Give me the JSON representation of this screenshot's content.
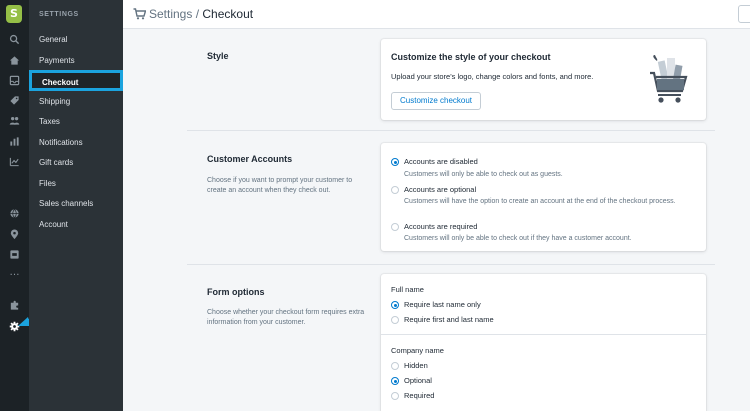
{
  "nav": {
    "heading": "SETTINGS",
    "items": [
      {
        "label": "General"
      },
      {
        "label": "Payments"
      },
      {
        "label": "Checkout"
      },
      {
        "label": "Shipping"
      },
      {
        "label": "Taxes"
      },
      {
        "label": "Notifications"
      },
      {
        "label": "Gift cards"
      },
      {
        "label": "Files"
      },
      {
        "label": "Sales channels"
      },
      {
        "label": "Account"
      }
    ],
    "active": "Checkout",
    "accent_color": "#1ba3de"
  },
  "topbar": {
    "breadcrumb_parent": "Settings",
    "separator": " / ",
    "breadcrumb_current": "Checkout"
  },
  "style_section": {
    "title": "Style",
    "card_title": "Customize the style of your checkout",
    "card_text": "Upload your store's logo, change colors and fonts, and more.",
    "button_label": "Customize checkout"
  },
  "accounts_section": {
    "title": "Customer Accounts",
    "description": "Choose if you want to prompt your customer to create an account when they check out.",
    "options": [
      {
        "label": "Accounts are disabled",
        "help": "Customers will only be able to check out as guests.",
        "checked": true
      },
      {
        "label": "Accounts are optional",
        "help": "Customers will have the option to create an account at the end of the checkout process.",
        "checked": false
      },
      {
        "label": "Accounts are required",
        "help": "Customers will only be able to check out if they have a customer account.",
        "checked": false
      }
    ]
  },
  "form_section": {
    "title": "Form options",
    "description": "Choose whether your checkout form requires extra information from your customer.",
    "full_name": {
      "label": "Full name",
      "options": [
        {
          "label": "Require last name only",
          "checked": true
        },
        {
          "label": "Require first and last name",
          "checked": false
        }
      ]
    },
    "company_name": {
      "label": "Company name",
      "options": [
        {
          "label": "Hidden",
          "checked": false
        },
        {
          "label": "Optional",
          "checked": true
        },
        {
          "label": "Required",
          "checked": false
        }
      ]
    }
  },
  "colors": {
    "primary_blue": "#007ace",
    "brand_green": "#95bf47",
    "annotation_arrow": "#1ba3de"
  }
}
